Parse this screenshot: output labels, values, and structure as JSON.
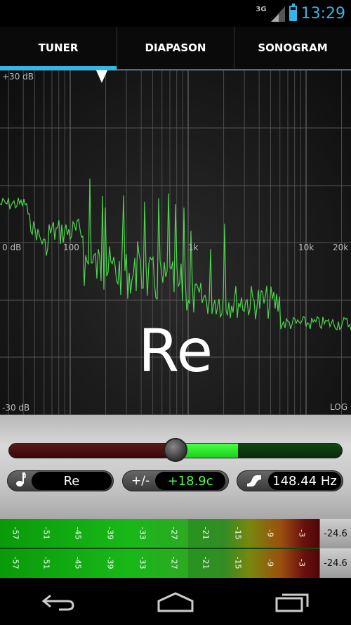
{
  "status": {
    "network": "3G",
    "time": "13:29",
    "battery_level": 0.8,
    "accent": "#33b5e5"
  },
  "tabs": [
    {
      "label": "TUNER",
      "active": true
    },
    {
      "label": "DIAPASON",
      "active": false
    },
    {
      "label": "SONOGRAM",
      "active": false
    }
  ],
  "spectrum": {
    "db_top": "+30 dB",
    "db_mid": "0 dB",
    "db_bottom": "-30 dB",
    "freq_labels": [
      "100",
      "1k",
      "10k",
      "20k"
    ],
    "scale": "LOG",
    "note": "Re",
    "line_color": "#4fd44f"
  },
  "tuner": {
    "note_label": "Re",
    "offset_label": "+/-",
    "offset_value": "+18.9c",
    "frequency_value": "148.44 Hz"
  },
  "level": {
    "ticks": [
      "-57",
      "-51",
      "-45",
      "-39",
      "-33",
      "-27",
      "-21",
      "-15",
      "-9",
      "-3"
    ],
    "peak_top": "-24.6",
    "peak_bottom": "-24.6"
  },
  "nav": {
    "back_icon": "back-icon",
    "home_icon": "home-icon",
    "recents_icon": "recents-icon"
  }
}
